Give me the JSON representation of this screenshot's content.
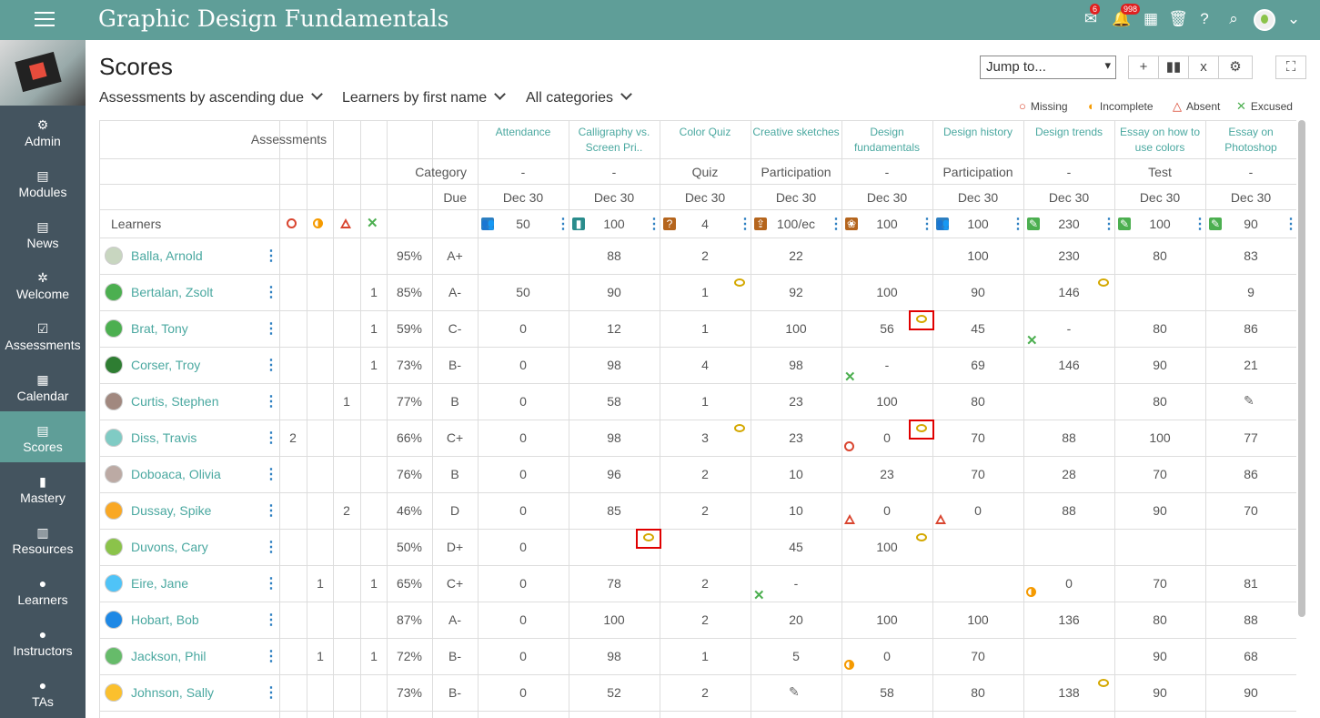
{
  "app": {
    "title": "Graphic Design Fundamentals",
    "mail_badge": "6",
    "bell_badge": "998"
  },
  "sidebar": {
    "items": [
      {
        "label": "Admin",
        "icon": "gear-icon"
      },
      {
        "label": "Modules",
        "icon": "modules-icon"
      },
      {
        "label": "News",
        "icon": "news-icon"
      },
      {
        "label": "Welcome",
        "icon": "welcome-icon"
      },
      {
        "label": "Assessments",
        "icon": "assessments-icon"
      },
      {
        "label": "Calendar",
        "icon": "calendar-icon"
      },
      {
        "label": "Scores",
        "icon": "scores-icon",
        "active": true
      },
      {
        "label": "Mastery",
        "icon": "mastery-icon"
      },
      {
        "label": "Resources",
        "icon": "resources-icon"
      },
      {
        "label": "Learners",
        "icon": "learner-icon"
      },
      {
        "label": "Instructors",
        "icon": "instructor-icon"
      },
      {
        "label": "TAs",
        "icon": "ta-icon"
      }
    ]
  },
  "page": {
    "title": "Scores"
  },
  "filters": [
    "Assessments by ascending due",
    "Learners by first name",
    "All categories"
  ],
  "jump": {
    "label": "Jump to..."
  },
  "legend": {
    "missing": "Missing",
    "incomplete": "Incomplete",
    "absent": "Absent",
    "excused": "Excused"
  },
  "grid": {
    "assessments_label": "Assessments",
    "category_label": "Category",
    "due_label": "Due",
    "learners_label": "Learners",
    "columns": [
      {
        "title": "Attendance",
        "category": "-",
        "due": "Dec 30",
        "points": "50",
        "icon": "attendance-icon",
        "color": "#2d7fc1"
      },
      {
        "title": "Calligraphy vs. Screen Pri..",
        "category": "-",
        "due": "Dec 30",
        "points": "100",
        "icon": "book-icon",
        "color": "#2a8c8c"
      },
      {
        "title": "Color Quiz",
        "category": "Quiz",
        "due": "Dec 30",
        "points": "4",
        "icon": "quiz-icon",
        "color": "#b5651d"
      },
      {
        "title": "Creative sketches",
        "category": "Participation",
        "due": "Dec 30",
        "points": "100/ec",
        "icon": "dropbox-icon",
        "color": "#b5651d"
      },
      {
        "title": "Design fundamentals",
        "category": "-",
        "due": "Dec 30",
        "points": "100",
        "icon": "palette-icon",
        "color": "#b5651d"
      },
      {
        "title": "Design history",
        "category": "Participation",
        "due": "Dec 30",
        "points": "100",
        "icon": "attendance-icon",
        "color": "#2d7fc1"
      },
      {
        "title": "Design trends",
        "category": "-",
        "due": "Dec 30",
        "points": "230",
        "icon": "pencil-icon",
        "color": "#4caf50"
      },
      {
        "title": "Essay on how to use colors",
        "category": "Test",
        "due": "Dec 30",
        "points": "100",
        "icon": "pencil-icon",
        "color": "#4caf50"
      },
      {
        "title": "Essay on Photoshop",
        "category": "-",
        "due": "Dec 30",
        "points": "90",
        "icon": "pencil-icon",
        "color": "#4caf50"
      }
    ],
    "rows": [
      {
        "name": "Balla, Arnold",
        "avatar": "#c8d6c0",
        "missing": "",
        "incomplete": "",
        "absent": "",
        "excused": "",
        "pct": "95%",
        "grade": "A+",
        "scores": [
          "",
          "88",
          "2",
          "22",
          "",
          "100",
          "230",
          "80",
          "83"
        ]
      },
      {
        "name": "Bertalan, Zsolt",
        "avatar": "#4caf50",
        "missing": "",
        "incomplete": "",
        "absent": "",
        "excused": "1",
        "pct": "85%",
        "grade": "A-",
        "scores": [
          "50",
          "90",
          "1",
          "92",
          "100",
          "90",
          "146",
          "",
          "9"
        ]
      },
      {
        "name": "Brat, Tony",
        "avatar": "#4caf50",
        "missing": "",
        "incomplete": "",
        "absent": "",
        "excused": "1",
        "pct": "59%",
        "grade": "C-",
        "scores": [
          "0",
          "12",
          "1",
          "100",
          "56",
          "45",
          "-",
          "80",
          "86"
        ]
      },
      {
        "name": "Corser, Troy",
        "avatar": "#2e7d32",
        "missing": "",
        "incomplete": "",
        "absent": "",
        "excused": "1",
        "pct": "73%",
        "grade": "B-",
        "scores": [
          "0",
          "98",
          "4",
          "98",
          "-",
          "69",
          "146",
          "90",
          "21"
        ]
      },
      {
        "name": "Curtis, Stephen",
        "avatar": "#a1887f",
        "missing": "",
        "incomplete": "",
        "absent": "1",
        "excused": "",
        "pct": "77%",
        "grade": "B",
        "scores": [
          "0",
          "58",
          "1",
          "23",
          "100",
          "80",
          "",
          "80",
          ""
        ]
      },
      {
        "name": "Diss, Travis",
        "avatar": "#80cbc4",
        "missing": "2",
        "incomplete": "",
        "absent": "",
        "excused": "",
        "pct": "66%",
        "grade": "C+",
        "scores": [
          "0",
          "98",
          "3",
          "23",
          "0",
          "70",
          "88",
          "100",
          "77"
        ]
      },
      {
        "name": "Doboaca, Olivia",
        "avatar": "#bcaaa4",
        "missing": "",
        "incomplete": "",
        "absent": "",
        "excused": "",
        "pct": "76%",
        "grade": "B",
        "scores": [
          "0",
          "96",
          "2",
          "10",
          "23",
          "70",
          "28",
          "70",
          "86"
        ]
      },
      {
        "name": "Dussay, Spike",
        "avatar": "#f9a825",
        "missing": "",
        "incomplete": "",
        "absent": "2",
        "excused": "",
        "pct": "46%",
        "grade": "D",
        "scores": [
          "0",
          "85",
          "2",
          "10",
          "0",
          "0",
          "88",
          "90",
          "70"
        ]
      },
      {
        "name": "Duvons, Cary",
        "avatar": "#8bc34a",
        "missing": "",
        "incomplete": "",
        "absent": "",
        "excused": "",
        "pct": "50%",
        "grade": "D+",
        "scores": [
          "0",
          "",
          "",
          "45",
          "100",
          "",
          "",
          "",
          ""
        ]
      },
      {
        "name": "Eire, Jane",
        "avatar": "#4fc3f7",
        "missing": "",
        "incomplete": "1",
        "absent": "",
        "excused": "1",
        "pct": "65%",
        "grade": "C+",
        "scores": [
          "0",
          "78",
          "2",
          "-",
          "",
          "",
          "0",
          "70",
          "81"
        ]
      },
      {
        "name": "Hobart, Bob",
        "avatar": "#1e88e5",
        "missing": "",
        "incomplete": "",
        "absent": "",
        "excused": "",
        "pct": "87%",
        "grade": "A-",
        "scores": [
          "0",
          "100",
          "2",
          "20",
          "100",
          "100",
          "136",
          "80",
          "88"
        ]
      },
      {
        "name": "Jackson, Phil",
        "avatar": "#66bb6a",
        "missing": "",
        "incomplete": "1",
        "absent": "",
        "excused": "1",
        "pct": "72%",
        "grade": "B-",
        "scores": [
          "0",
          "98",
          "1",
          "5",
          "0",
          "70",
          "",
          "90",
          "68"
        ]
      },
      {
        "name": "Johnson, Sally",
        "avatar": "#fbc02d",
        "missing": "",
        "incomplete": "",
        "absent": "",
        "excused": "",
        "pct": "73%",
        "grade": "B-",
        "scores": [
          "0",
          "52",
          "2",
          "",
          "58",
          "80",
          "138",
          "90",
          "90"
        ]
      }
    ]
  }
}
